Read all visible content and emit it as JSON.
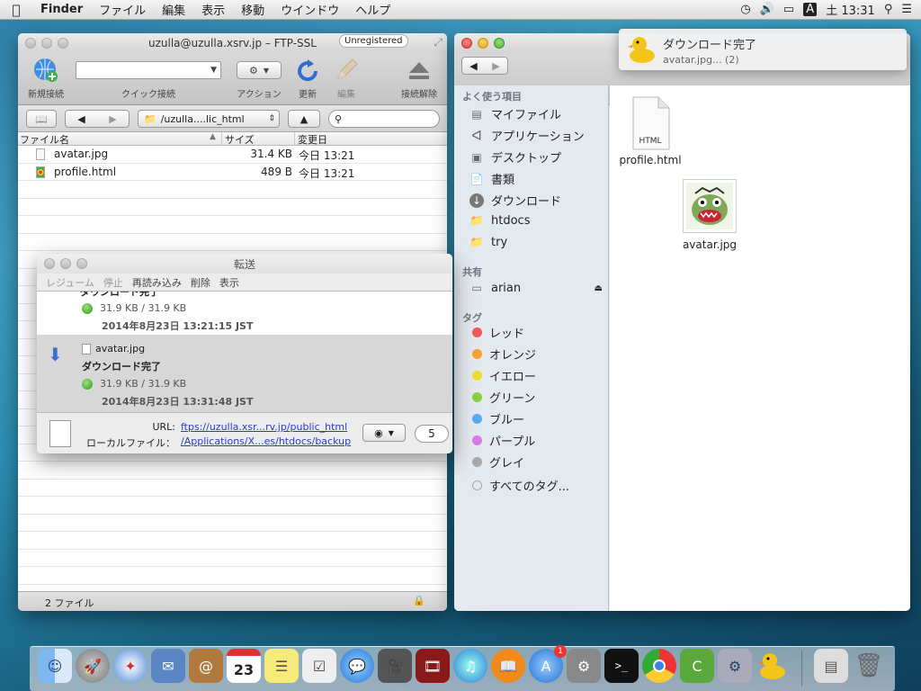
{
  "menubar": {
    "app": "Finder",
    "items": [
      "ファイル",
      "編集",
      "表示",
      "移動",
      "ウインドウ",
      "ヘルプ"
    ],
    "clock": "土 13:31",
    "input_indicator": "A"
  },
  "cyberduck": {
    "title": "uzulla@uzulla.xsrv.jp – FTP-SSL",
    "badge": "Unregistered",
    "toolbar": {
      "new_connection": "新規接続",
      "quick_connect": "クイック接続",
      "action": "アクション",
      "refresh": "更新",
      "edit": "編集",
      "disconnect": "接続解除"
    },
    "path": "/uzulla....lic_html",
    "columns": {
      "name": "ファイル名",
      "size": "サイズ",
      "modified": "変更日"
    },
    "files": [
      {
        "name": "avatar.jpg",
        "size": "31.4 KB",
        "modified": "今日 13:21"
      },
      {
        "name": "profile.html",
        "size": "489 B",
        "modified": "今日 13:21"
      }
    ],
    "status": "2 ファイル"
  },
  "transfer": {
    "title": "転送",
    "tools": [
      "レジューム",
      "停止",
      "再読み込み",
      "削除",
      "表示"
    ],
    "entries": [
      {
        "partial_status": "ダウンロード完了",
        "progress": "31.9 KB / 31.9 KB",
        "date": "2014年8月23日 13:21:15 JST"
      },
      {
        "file": "avatar.jpg",
        "status": "ダウンロード完了",
        "progress": "31.9 KB / 31.9 KB",
        "date": "2014年8月23日 13:31:48 JST"
      }
    ],
    "url_label": "URL:",
    "url": "ftps://uzulla.xsr...rv.jp/public_html",
    "local_label": "ローカルファイル：",
    "local": "/Applications/X...es/htdocs/backup",
    "connections": "5"
  },
  "notification": {
    "title": "ダウンロード完了",
    "body": "avatar.jpg... (2)"
  },
  "finder": {
    "favorites_head": "よく使う項目",
    "favorites": [
      "マイファイル",
      "アプリケーション",
      "デスクトップ",
      "書類",
      "ダウンロード",
      "htdocs",
      "try"
    ],
    "shared_head": "共有",
    "shared": [
      "arian"
    ],
    "tags_head": "タグ",
    "tags": [
      {
        "label": "レッド",
        "color": "#f05a55"
      },
      {
        "label": "オレンジ",
        "color": "#f7a033"
      },
      {
        "label": "イエロー",
        "color": "#f2d92f"
      },
      {
        "label": "グリーン",
        "color": "#8ad03c"
      },
      {
        "label": "ブルー",
        "color": "#58aaf0"
      },
      {
        "label": "パープル",
        "color": "#d47de8"
      },
      {
        "label": "グレイ",
        "color": "#a9a9a9"
      }
    ],
    "all_tags": "すべてのタグ...",
    "files": [
      {
        "name": "profile.html",
        "icon_label": "HTML"
      },
      {
        "name": "avatar.jpg"
      }
    ]
  },
  "dock": {
    "calendar_day": "23",
    "app_store_badge": "1"
  }
}
